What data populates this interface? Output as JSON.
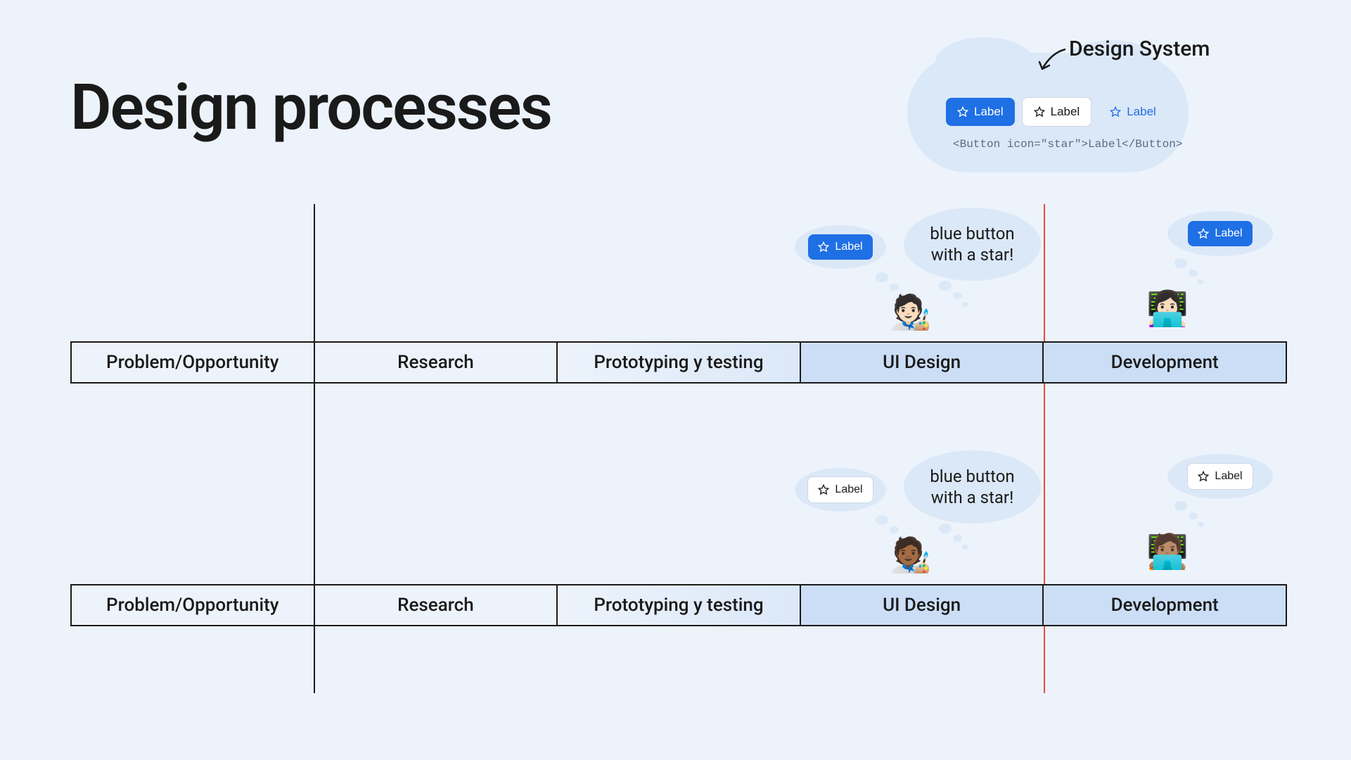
{
  "title": "Design processes",
  "design_system": {
    "label": "Design System",
    "buttons": [
      {
        "label": "Label",
        "variant": "primary"
      },
      {
        "label": "Label",
        "variant": "secondary"
      },
      {
        "label": "Label",
        "variant": "ghost"
      }
    ],
    "code": "<Button icon=\"star\">Label</Button>"
  },
  "process_stages": [
    "Problem/Opportunity",
    "Research",
    "Prototyping y testing",
    "UI Design",
    "Development"
  ],
  "designer_bubble": {
    "button_label": "Label",
    "text": "blue button with a star!"
  },
  "developer_bubble": {
    "button_label": "Label"
  },
  "row1": {
    "designer_emoji": "🧑🏻‍🎨",
    "developer_emoji": "👩🏻‍💻",
    "designer_button_variant": "primary",
    "developer_button_variant": "primary"
  },
  "row2": {
    "designer_emoji": "🧑🏾‍🎨",
    "developer_emoji": "🧑🏽‍💻",
    "designer_button_variant": "secondary",
    "developer_button_variant": "secondary"
  }
}
